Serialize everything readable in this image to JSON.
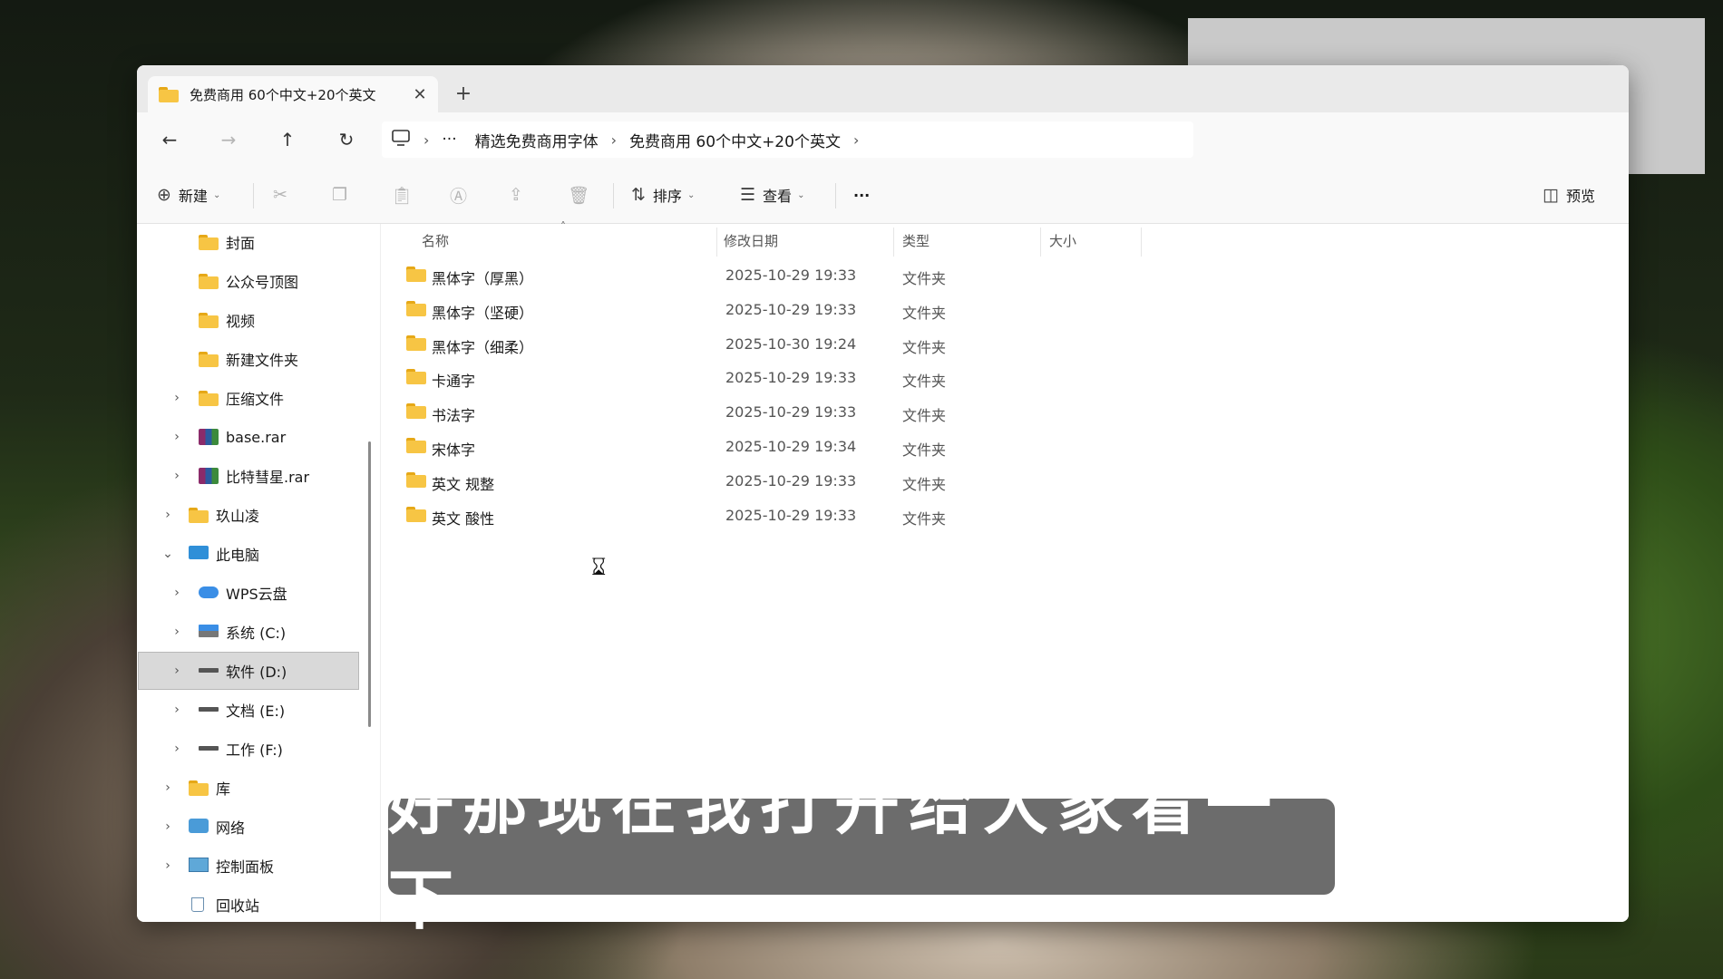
{
  "tab": {
    "title": "免费商用 60个中文+20个英文",
    "close": "✕",
    "new_tab": "+"
  },
  "nav": {
    "back": "←",
    "forward": "→",
    "up": "↑",
    "refresh": "↻",
    "more": "···",
    "breadcrumb": [
      "精选免费商用字体",
      "免费商用 60个中文+20个英文"
    ]
  },
  "toolbar": {
    "new_label": "新建",
    "sort_label": "排序",
    "view_label": "查看",
    "more": "···",
    "preview_label": "预览"
  },
  "sidebar": {
    "items": [
      {
        "label": "封面"
      },
      {
        "label": "公众号顶图"
      },
      {
        "label": "视频"
      },
      {
        "label": "新建文件夹"
      },
      {
        "label": "压缩文件"
      },
      {
        "label": "base.rar"
      },
      {
        "label": "比特彗星.rar"
      },
      {
        "label": "玖山凌"
      },
      {
        "label": "此电脑"
      },
      {
        "label": "WPS云盘"
      },
      {
        "label": "系统 (C:)"
      },
      {
        "label": "软件 (D:)"
      },
      {
        "label": "文档 (E:)"
      },
      {
        "label": "工作 (F:)"
      },
      {
        "label": "库"
      },
      {
        "label": "网络"
      },
      {
        "label": "控制面板"
      },
      {
        "label": "回收站"
      }
    ]
  },
  "columns": {
    "name": "名称",
    "date": "修改日期",
    "type": "类型",
    "size": "大小"
  },
  "files": [
    {
      "name": "黑体字（厚黑）",
      "date": "2025-10-29 19:33",
      "type": "文件夹"
    },
    {
      "name": "黑体字（坚硬）",
      "date": "2025-10-29 19:33",
      "type": "文件夹"
    },
    {
      "name": "黑体字（细柔）",
      "date": "2025-10-30 19:24",
      "type": "文件夹"
    },
    {
      "name": "卡通字",
      "date": "2025-10-29 19:33",
      "type": "文件夹"
    },
    {
      "name": "书法字",
      "date": "2025-10-29 19:33",
      "type": "文件夹"
    },
    {
      "name": "宋体字",
      "date": "2025-10-29 19:34",
      "type": "文件夹"
    },
    {
      "name": "英文 规整",
      "date": "2025-10-29 19:33",
      "type": "文件夹"
    },
    {
      "name": "英文 酸性",
      "date": "2025-10-29 19:33",
      "type": "文件夹"
    }
  ],
  "subtitle": "好那现在我打开给大家看一下",
  "colors": {
    "folder": "#f7c544",
    "selection": "#d9d9d9"
  }
}
